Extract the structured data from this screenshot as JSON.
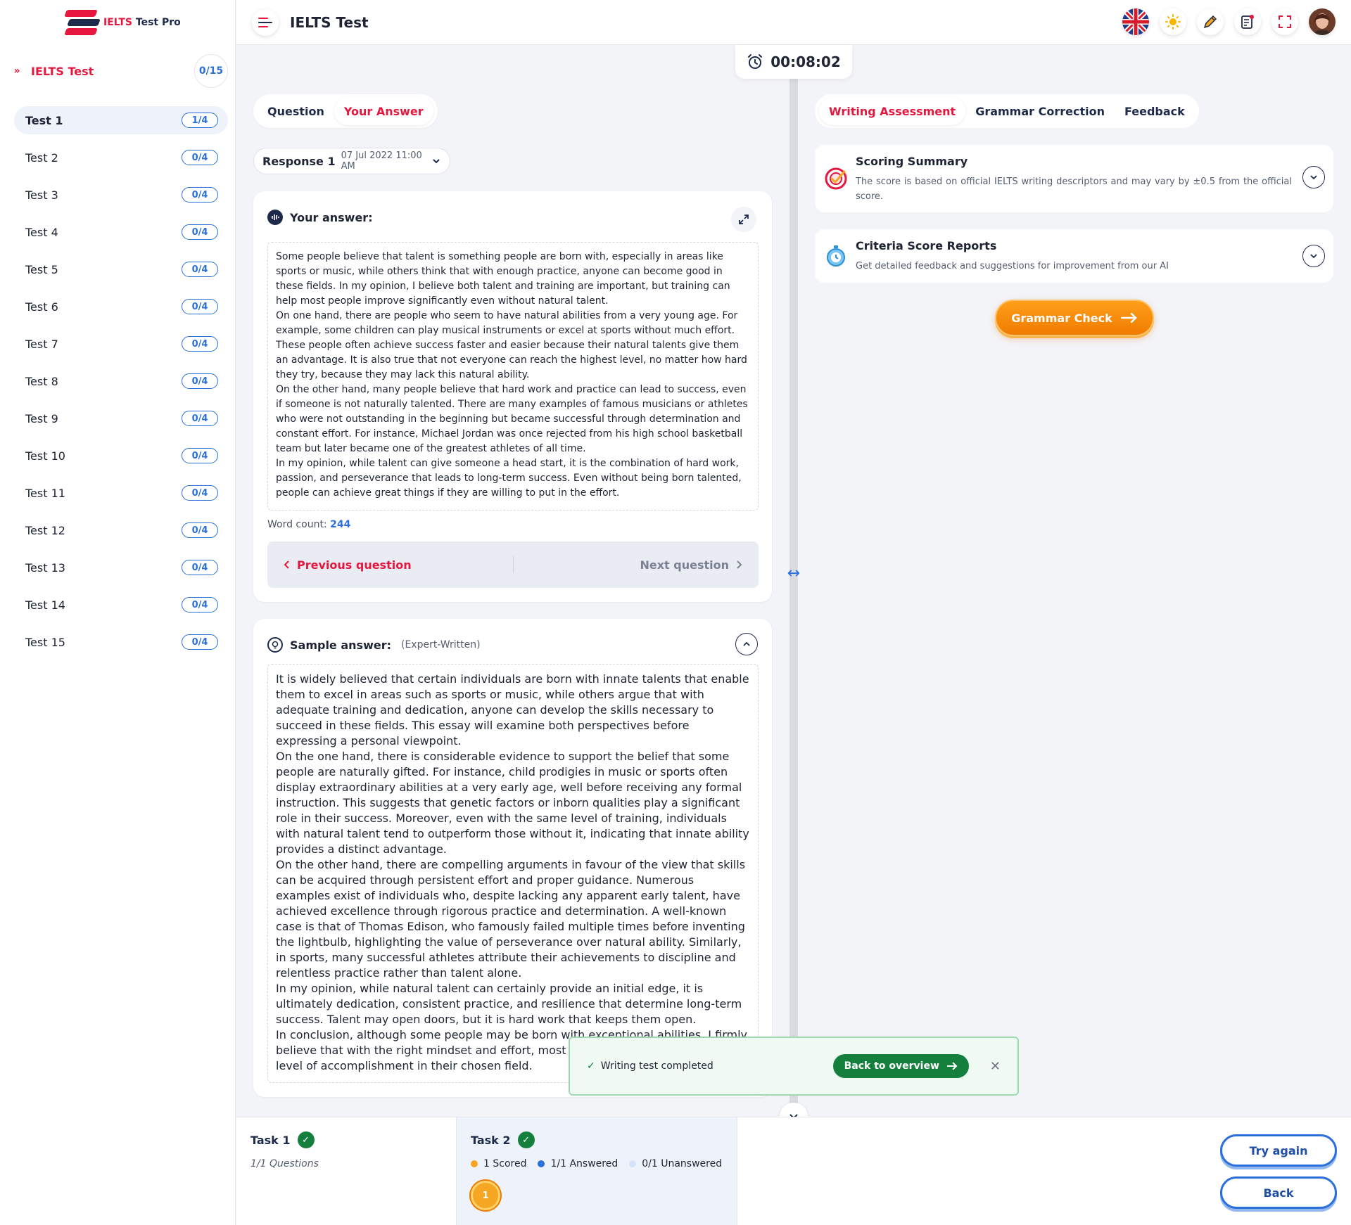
{
  "app": {
    "brand": "IELTS",
    "brand_suffix": "Test Pro",
    "header_title": "IELTS Test"
  },
  "sidebar": {
    "section_title": "IELTS Test",
    "section_progress": "0/15",
    "tests": [
      {
        "label": "Test 1",
        "progress": "1/4",
        "active": true
      },
      {
        "label": "Test 2",
        "progress": "0/4"
      },
      {
        "label": "Test 3",
        "progress": "0/4"
      },
      {
        "label": "Test 4",
        "progress": "0/4"
      },
      {
        "label": "Test 5",
        "progress": "0/4"
      },
      {
        "label": "Test 6",
        "progress": "0/4"
      },
      {
        "label": "Test 7",
        "progress": "0/4"
      },
      {
        "label": "Test 8",
        "progress": "0/4"
      },
      {
        "label": "Test 9",
        "progress": "0/4"
      },
      {
        "label": "Test 10",
        "progress": "0/4"
      },
      {
        "label": "Test 11",
        "progress": "0/4"
      },
      {
        "label": "Test 12",
        "progress": "0/4"
      },
      {
        "label": "Test 13",
        "progress": "0/4"
      },
      {
        "label": "Test 14",
        "progress": "0/4"
      },
      {
        "label": "Test 15",
        "progress": "0/4"
      }
    ]
  },
  "header": {
    "icons": [
      "uk-flag-icon",
      "sun-icon",
      "pencil-icon",
      "notes-icon",
      "fullscreen-icon",
      "avatar"
    ]
  },
  "timer": {
    "value": "00:08:02"
  },
  "left_tabs": [
    "Question",
    "Your Answer"
  ],
  "response": {
    "name": "Response 1",
    "date": "07 Jul 2022 11:00 AM"
  },
  "answer": {
    "title": "Your answer:",
    "paragraphs": [
      "Some people believe that talent is something people are born with, especially in areas like sports or music, while others think that with enough practice, anyone can become good in these fields. In my opinion, I believe both talent and training are important, but training can help most people improve significantly even without natural talent.",
      "On one hand, there are people who seem to have natural abilities from a very young age. For example, some children can play musical instruments or excel at sports without much effort. These people often achieve success faster and easier because their natural talents give them an advantage. It is also true that not everyone can reach the highest level, no matter how hard they try, because they may lack this natural ability.",
      "On the other hand, many people believe that hard work and practice can lead to success, even if someone is not naturally talented. There are many examples of famous musicians or athletes who were not outstanding in the beginning but became successful through determination and constant effort. For instance, Michael Jordan was once rejected from his high school basketball team but later became one of the greatest athletes of all time.",
      "In my opinion, while talent can give someone a head start, it is the combination of hard work, passion, and perseverance that leads to long-term success. Even without being born talented, people can achieve great things if they are willing to put in the effort."
    ],
    "word_count_label": "Word count:",
    "word_count": "244",
    "prev_label": "Previous question",
    "next_label": "Next question"
  },
  "sample": {
    "title": "Sample answer:",
    "subtitle": "(Expert-Written)",
    "paragraphs": [
      "It is widely believed that certain individuals are born with innate talents that enable them to excel in areas such as sports or music, while others argue that with adequate training and dedication, anyone can develop the skills necessary to succeed in these fields. This essay will examine both perspectives before expressing a personal viewpoint.",
      "On the one hand, there is considerable evidence to support the belief that some people are naturally gifted. For instance, child prodigies in music or sports often display extraordinary abilities at a very early age, well before receiving any formal instruction. This suggests that genetic factors or inborn qualities play a significant role in their success. Moreover, even with the same level of training, individuals with natural talent tend to outperform those without it, indicating that innate ability provides a distinct advantage.",
      "On the other hand, there are compelling arguments in favour of the view that skills can be acquired through persistent effort and proper guidance. Numerous examples exist of individuals who, despite lacking any apparent early talent, have achieved excellence through rigorous practice and determination. A well-known case is that of Thomas Edison, who famously failed multiple times before inventing the lightbulb, highlighting the value of perseverance over natural ability. Similarly, in sports, many successful athletes attribute their achievements to discipline and relentless practice rather than talent alone.",
      "In my opinion, while natural talent can certainly provide an initial edge, it is ultimately dedication, consistent practice, and resilience that determine long-term success. Talent may open doors, but it is hard work that keeps them open.",
      "In conclusion, although some people may be born with exceptional abilities, I firmly believe that with the right mindset and effort, most individuals can reach a high level of accomplishment in their chosen field."
    ]
  },
  "right_tabs": [
    "Writing Assessment",
    "Grammar Correction",
    "Feedback"
  ],
  "scoring_summary": {
    "title": "Scoring Summary",
    "desc": "The score is based on official IELTS writing descriptors and may vary by ±0.5 from the official score."
  },
  "criteria_reports": {
    "title": "Criteria Score Reports",
    "desc": "Get detailed feedback and suggestions for improvement from our AI"
  },
  "grammar_check_label": "Grammar Check",
  "toast": {
    "message": "Writing test completed",
    "action": "Back to overview"
  },
  "footer": {
    "task1": {
      "title": "Task 1",
      "sub": "1/1 Questions"
    },
    "task2": {
      "title": "Task 2",
      "legend": [
        {
          "label": "1 Scored",
          "color": "#f5a623"
        },
        {
          "label": "1/1 Answered",
          "color": "#2a6fdb"
        },
        {
          "label": "0/1 Unanswered",
          "color": "#d6e2f7"
        }
      ],
      "question_number": "1"
    },
    "try_again": "Try again",
    "back": "Back"
  },
  "colors": {
    "accent": "#e5173f",
    "primary": "#2a6fdb",
    "success": "#15803d",
    "orange": "#f07b00"
  }
}
